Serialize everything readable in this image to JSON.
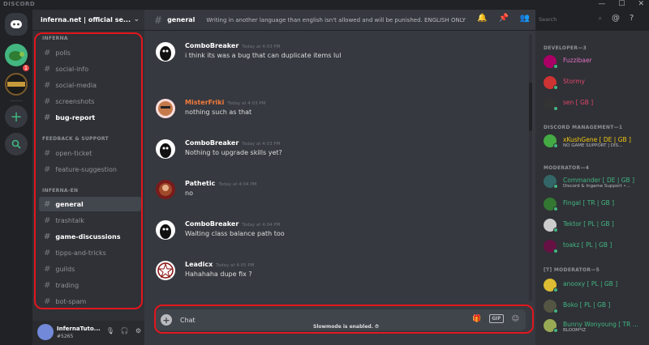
{
  "app": {
    "brand": "DISCORD",
    "window_controls": [
      "—",
      "☐",
      "✕"
    ]
  },
  "guilds": {
    "turtle_badge": "1"
  },
  "server": {
    "name": "inferna.net | official se..."
  },
  "categories": [
    {
      "label": "INFERNA"
    },
    {
      "label": "FEEDBACK & SUPPORT"
    },
    {
      "label": "INFERNA-EN"
    }
  ],
  "channels": [
    {
      "label": "polls"
    },
    {
      "label": "social-info"
    },
    {
      "label": "social-media"
    },
    {
      "label": "screenshots"
    },
    {
      "label": "bug-report"
    },
    {
      "label": "open-ticket"
    },
    {
      "label": "feature-suggestion"
    },
    {
      "label": "general"
    },
    {
      "label": "trashtalk"
    },
    {
      "label": "game-discussions"
    },
    {
      "label": "tipps-and-tricks"
    },
    {
      "label": "guilds"
    },
    {
      "label": "trading"
    },
    {
      "label": "bot-spam"
    }
  ],
  "user": {
    "name": "InfernaTuto...",
    "tag": "#5265"
  },
  "chat": {
    "channel": "general",
    "topic": "Writing in another language than english isn't allowed and will be punished. ENGLISH ONLY",
    "messages": [
      {
        "author": "ComboBreaker",
        "time": "Today at 4:03 PM",
        "text": "i think its was a bug that can duplicate items lul"
      },
      {
        "author": "MisterFriki",
        "time": "Today at 4:03 PM",
        "text": "nothing such as that"
      },
      {
        "author": "ComboBreaker",
        "time": "Today at 4:03 PM",
        "text": "Nothing to upgrade skills yet?"
      },
      {
        "author": "Pathetic",
        "time": "Today at 4:04 PM",
        "text": "no"
      },
      {
        "author": "ComboBreaker",
        "time": "Today at 4:04 PM",
        "text": "Waiting class balance path too"
      },
      {
        "author": "Leadicx",
        "time": "Today at 4:05 PM",
        "text": "Hahahaha dupe fix ?"
      }
    ],
    "composer_value": "Chat",
    "gif_label": "GIF",
    "slowmode": "Slowmode is enabled."
  },
  "search": {
    "placeholder": "Search"
  },
  "members": {
    "categories": [
      {
        "label": "DEVELOPER—3"
      },
      {
        "label": "DISCORD MANAGEMENT—1"
      },
      {
        "label": "MODERATOR—4"
      },
      {
        "label": "[T] MODERATOR—5"
      }
    ],
    "list": [
      {
        "name": "Fuzzibaer",
        "sub": "",
        "color": "#e36fc4"
      },
      {
        "name": "Stormy",
        "sub": "",
        "color": "#e3466a"
      },
      {
        "name": "sen [ GB ]",
        "sub": "",
        "color": "#e3466a"
      },
      {
        "name": "xKushGene [ DE | GB ]",
        "sub": "NO GAME SUPPORT | DIS...",
        "color": "#f1c40f"
      },
      {
        "name": "Commander [ DE | GB ]",
        "sub": "Discord & Ingame Support •...",
        "color": "#43b581"
      },
      {
        "name": "Fingal [ TR | GB ]",
        "sub": "",
        "color": "#43b581"
      },
      {
        "name": "Tektor [ PL | GB ]",
        "sub": "",
        "color": "#43b581"
      },
      {
        "name": "toakz [ PL | GB ]",
        "sub": "",
        "color": "#43b581"
      },
      {
        "name": "anooxy [ PL | GB ]",
        "sub": "",
        "color": "#43b581"
      },
      {
        "name": "Boko [ PL | GB ]",
        "sub": "",
        "color": "#43b581"
      },
      {
        "name": "Bunny Wonyoung [ TR ...",
        "sub": "BLOOM*IZ",
        "color": "#43b581"
      }
    ]
  }
}
